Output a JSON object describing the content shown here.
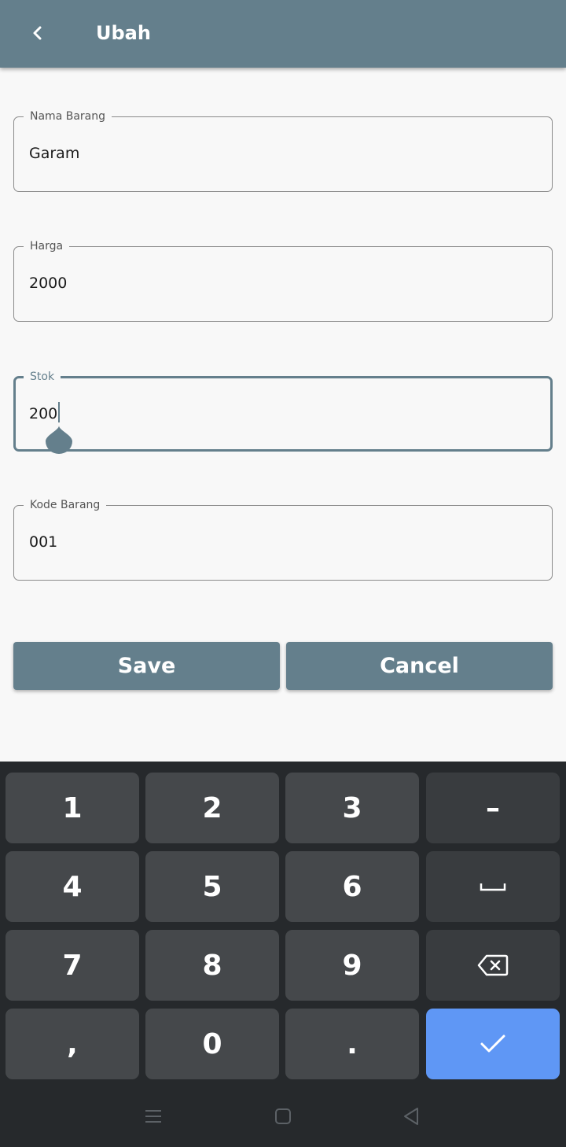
{
  "colors": {
    "accent": "#647f8c",
    "keyboard_bg": "#26292c",
    "key_bg": "#45484b",
    "enter_key": "#5f97f5"
  },
  "app_bar": {
    "title": "Ubah",
    "back_icon": "chevron-left-icon"
  },
  "form": {
    "fields": [
      {
        "label": "Nama Barang",
        "value": "Garam",
        "focused": false
      },
      {
        "label": "Harga",
        "value": "2000",
        "focused": false
      },
      {
        "label": "Stok",
        "value": "200",
        "focused": true
      },
      {
        "label": "Kode Barang",
        "value": "001",
        "focused": false
      }
    ],
    "save_label": "Save",
    "cancel_label": "Cancel"
  },
  "keyboard": {
    "keys": [
      "1",
      "2",
      "3",
      "–",
      "4",
      "5",
      "6",
      "space",
      "7",
      "8",
      "9",
      "backspace",
      ",",
      "0",
      ".",
      "enter"
    ],
    "key_labels": {
      "k1": "1",
      "k2": "2",
      "k3": "3",
      "minus": "–",
      "k4": "4",
      "k5": "5",
      "k6": "6",
      "k7": "7",
      "k8": "8",
      "k9": "9",
      "comma": ",",
      "k0": "0",
      "period": "."
    },
    "icons": {
      "space": "space-bar-icon",
      "backspace": "backspace-icon",
      "enter": "checkmark-icon"
    }
  },
  "navigation_bar": {
    "icons": [
      "menu-icon",
      "home-square-icon",
      "back-triangle-icon"
    ]
  }
}
